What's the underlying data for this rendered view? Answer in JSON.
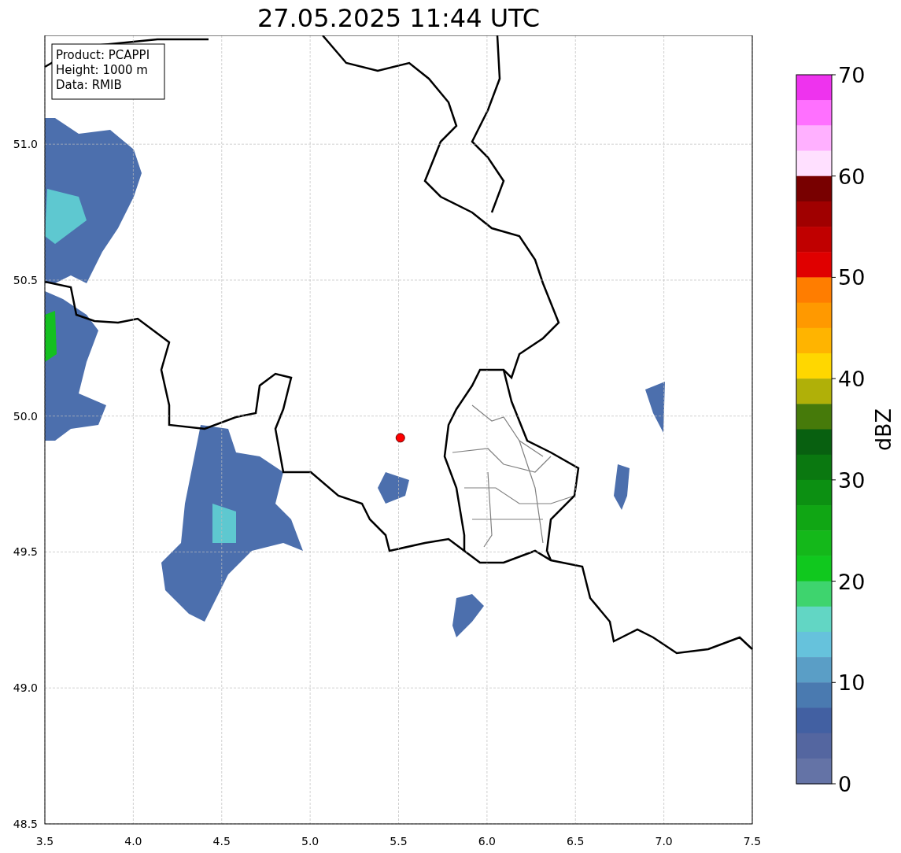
{
  "title": "27.05.2025 11:44 UTC",
  "map": {
    "info_lines": [
      "Product: PCAPPI",
      "Height: 1000 m",
      "Data: RMIB"
    ],
    "chart_data": {
      "type": "scatter",
      "grid": true,
      "xlim": [
        3.5,
        7.5
      ],
      "ylim": [
        48.5,
        51.4
      ],
      "xticks": [
        {
          "value": 3.5,
          "label": "3.5"
        },
        {
          "value": 4,
          "label": "4.0"
        },
        {
          "value": 4.5,
          "label": "4.5"
        },
        {
          "value": 5,
          "label": "5.0"
        },
        {
          "value": 5.5,
          "label": "5.5"
        },
        {
          "value": 6,
          "label": "6.0"
        },
        {
          "value": 6.5,
          "label": "6.5"
        },
        {
          "value": 7,
          "label": "7.0"
        },
        {
          "value": 7.5,
          "label": "7.5"
        }
      ],
      "yticks": [
        {
          "value": 48.5,
          "label": "48.5"
        },
        {
          "value": 49,
          "label": "49.0"
        },
        {
          "value": 49.5,
          "label": "49.5"
        },
        {
          "value": 50,
          "label": "50.0"
        },
        {
          "value": 50.5,
          "label": "50.5"
        },
        {
          "value": 51,
          "label": "51.0"
        }
      ],
      "x": [
        5.51
      ],
      "series": [
        {
          "color": "#ff0000",
          "values": [
            49.92
          ]
        }
      ]
    }
  },
  "colorbar": {
    "label": "dBZ",
    "ticks": [
      "70",
      "60",
      "50",
      "40",
      "30",
      "20",
      "10",
      "0"
    ],
    "segments": [
      {
        "color": "#ee33ee"
      },
      {
        "color": "#ff70ff"
      },
      {
        "color": "#ffb0ff"
      },
      {
        "color": "#ffe0ff"
      },
      {
        "color": "#780000"
      },
      {
        "color": "#a00000"
      },
      {
        "color": "#c00000"
      },
      {
        "color": "#e00000"
      },
      {
        "color": "#ff7d00"
      },
      {
        "color": "#ff9900"
      },
      {
        "color": "#ffb400"
      },
      {
        "color": "#ffd700"
      },
      {
        "color": "#b0b008"
      },
      {
        "color": "#467a0a"
      },
      {
        "color": "#086010"
      },
      {
        "color": "#0a7810"
      },
      {
        "color": "#0c9012"
      },
      {
        "color": "#10a614"
      },
      {
        "color": "#14b81a"
      },
      {
        "color": "#10c81e"
      },
      {
        "color": "#3ed46e"
      },
      {
        "color": "#62d6c4"
      },
      {
        "color": "#66c2dc"
      },
      {
        "color": "#5a9ec6"
      },
      {
        "color": "#4a7ab0"
      },
      {
        "color": "#4260a2"
      },
      {
        "color": "#5466a0"
      },
      {
        "color": "#6473a6"
      }
    ]
  }
}
